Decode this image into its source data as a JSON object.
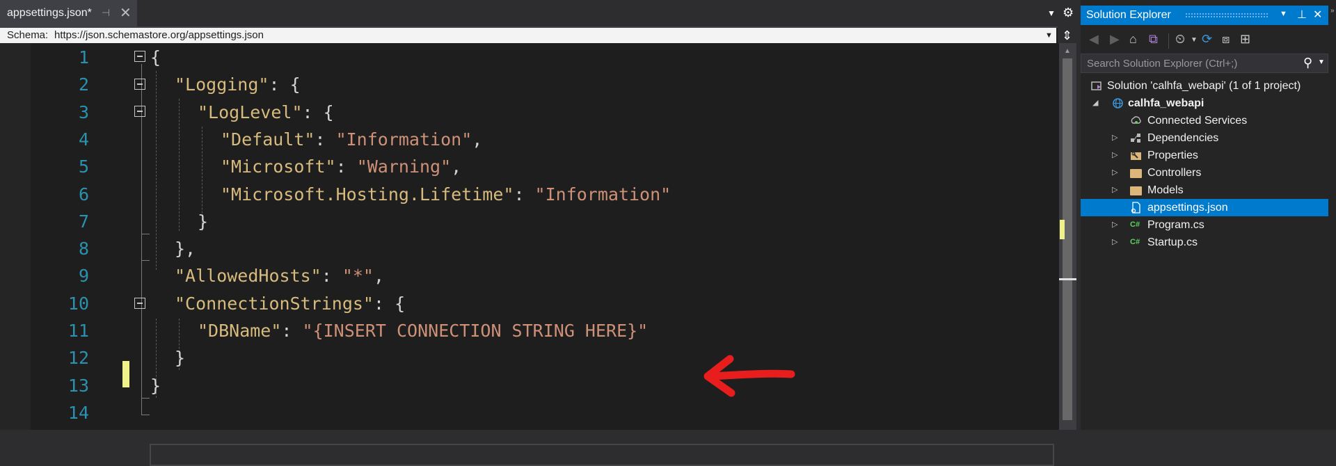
{
  "editor": {
    "tab": {
      "filename": "appsettings.json*",
      "pin_glyph": "⊣",
      "close_glyph": "✕"
    },
    "schema": {
      "label": "Schema:",
      "url": "https://json.schemastore.org/appsettings.json"
    },
    "line_numbers": [
      "1",
      "2",
      "3",
      "4",
      "5",
      "6",
      "7",
      "8",
      "9",
      "10",
      "11",
      "12",
      "13",
      "14"
    ],
    "code": {
      "l1_brace": "{",
      "l2_key": "\"Logging\"",
      "l2_rest": ": {",
      "l3_key": "\"LogLevel\"",
      "l3_rest": ": {",
      "l4_key": "\"Default\"",
      "l4_sep": ": ",
      "l4_val": "\"Information\"",
      "l4_end": ",",
      "l5_key": "\"Microsoft\"",
      "l5_sep": ": ",
      "l5_val": "\"Warning\"",
      "l5_end": ",",
      "l6_key": "\"Microsoft.Hosting.Lifetime\"",
      "l6_sep": ": ",
      "l6_val": "\"Information\"",
      "l7": "}",
      "l8": "},",
      "l9_key": "\"AllowedHosts\"",
      "l9_sep": ": ",
      "l9_val": "\"*\"",
      "l9_end": ",",
      "l10_key": "\"ConnectionStrings\"",
      "l10_rest": ": {",
      "l11_key": "\"DBName\"",
      "l11_sep": ": ",
      "l11_val": "\"{INSERT CONNECTION STRING HERE}\"",
      "l12": "}",
      "l13": "}"
    }
  },
  "solution_explorer": {
    "title": "Solution Explorer",
    "search_placeholder": "Search Solution Explorer (Ctrl+;)",
    "tree": {
      "solution": "Solution 'calhfa_webapi' (1 of 1 project)",
      "project": "calhfa_webapi",
      "items": [
        "Connected Services",
        "Dependencies",
        "Properties",
        "Controllers",
        "Models",
        "appsettings.json",
        "Program.cs",
        "Startup.cs"
      ],
      "selected": "appsettings.json"
    }
  },
  "colors": {
    "accent": "#007acc",
    "editor_bg": "#1e1e1e",
    "json_key": "#d7ba7d",
    "json_string": "#ce9178",
    "line_number": "#2b91af",
    "change_marker": "#eff28a",
    "annotation_arrow": "#e81d1d"
  },
  "icons": [
    "pin-icon",
    "close-icon",
    "settings-icon",
    "split-icon",
    "back-icon",
    "forward-icon",
    "home-icon",
    "switch-views-icon",
    "pending-changes-icon",
    "refresh-icon",
    "collapse-all-icon",
    "show-all-files-icon",
    "search-icon",
    "connected-services-icon",
    "dependencies-icon",
    "wrench-icon",
    "folder-icon",
    "json-file-icon",
    "csharp-file-icon",
    "web-project-icon",
    "solution-icon"
  ]
}
